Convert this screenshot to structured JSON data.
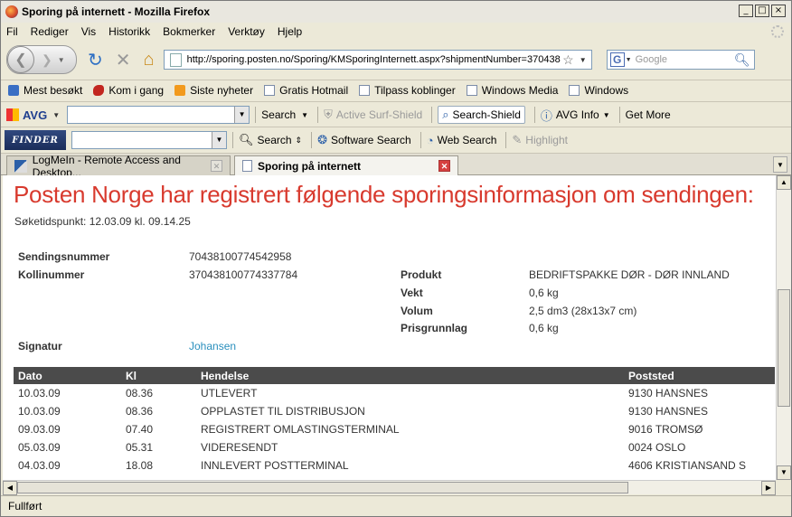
{
  "window": {
    "title": "Sporing på internett - Mozilla Firefox"
  },
  "menu": [
    "Fil",
    "Rediger",
    "Vis",
    "Historikk",
    "Bokmerker",
    "Verktøy",
    "Hjelp"
  ],
  "nav": {
    "url": "http://sporing.posten.no/Sporing/KMSporingInternett.aspx?shipmentNumber=370438",
    "search_placeholder": "Google"
  },
  "bookmarks": [
    {
      "label": "Mest besøkt",
      "icon": "blue"
    },
    {
      "label": "Kom i gang",
      "icon": "red"
    },
    {
      "label": "Siste nyheter",
      "icon": "rss"
    },
    {
      "label": "Gratis Hotmail",
      "icon": "page"
    },
    {
      "label": "Tilpass koblinger",
      "icon": "page"
    },
    {
      "label": "Windows Media",
      "icon": "page"
    },
    {
      "label": "Windows",
      "icon": "page"
    }
  ],
  "avg": {
    "logo": "AVG",
    "search": "Search",
    "surf_shield": "Active Surf-Shield",
    "search_shield": "Search-Shield",
    "info": "AVG Info",
    "get_more": "Get More"
  },
  "finder": {
    "logo": "FINDER",
    "search": "Search",
    "software_search": "Software Search",
    "web_search": "Web Search",
    "highlight": "Highlight"
  },
  "tabs": [
    {
      "label": "LogMeIn - Remote Access and Desktop...",
      "active": false
    },
    {
      "label": "Sporing på internett",
      "active": true
    }
  ],
  "page": {
    "heading": "Posten Norge har registrert følgende sporingsinformasjon om sendingen:",
    "search_time": "Søketidspunkt: 12.03.09 kl. 09.14.25",
    "details": {
      "sendingsnummer_label": "Sendingsnummer",
      "sendingsnummer": "70438100774542958",
      "kollinummer_label": "Kollinummer",
      "kollinummer": "370438100774337784",
      "signatur_label": "Signatur",
      "signatur": "Johansen",
      "produkt_label": "Produkt",
      "produkt": "BEDRIFTSPAKKE DØR - DØR INNLAND",
      "vekt_label": "Vekt",
      "vekt": "0,6 kg",
      "volum_label": "Volum",
      "volum": "2,5 dm3 (28x13x7 cm)",
      "prisgrunnlag_label": "Prisgrunnlag",
      "prisgrunnlag": "0,6 kg"
    },
    "table": {
      "headers": [
        "Dato",
        "Kl",
        "Hendelse",
        "Poststed"
      ],
      "rows": [
        [
          "10.03.09",
          "08.36",
          "UTLEVERT",
          "9130 HANSNES"
        ],
        [
          "10.03.09",
          "08.36",
          "OPPLASTET TIL DISTRIBUSJON",
          "9130 HANSNES"
        ],
        [
          "09.03.09",
          "07.40",
          "REGISTRERT OMLASTINGSTERMINAL",
          "9016 TROMSØ"
        ],
        [
          "05.03.09",
          "05.31",
          "VIDERESENDT",
          "0024 OSLO"
        ],
        [
          "04.03.09",
          "18.08",
          "INNLEVERT POSTTERMINAL",
          "4606 KRISTIANSAND S"
        ]
      ]
    }
  },
  "status": "Fullført",
  "colors": {
    "heading": "#d83a2e",
    "link": "#2a8fbd",
    "table_header": "#4b4b4b"
  }
}
